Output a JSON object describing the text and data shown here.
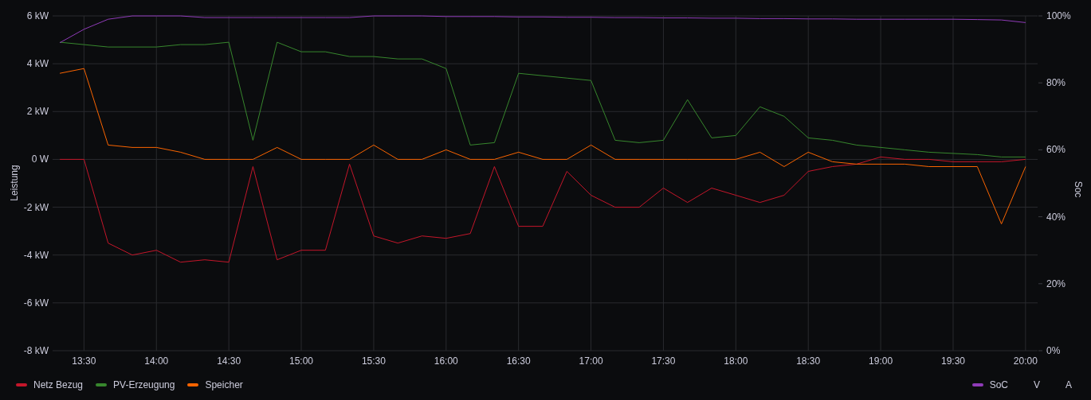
{
  "panel": {
    "chart_data": {
      "type": "line",
      "ylabel": "Leistung",
      "y2label": "Soc",
      "x": [
        800,
        810,
        820,
        830,
        840,
        850,
        860,
        870,
        880,
        890,
        900,
        910,
        920,
        930,
        940,
        950,
        960,
        970,
        980,
        990,
        1000,
        1010,
        1020,
        1030,
        1040,
        1050,
        1060,
        1070,
        1080,
        1090,
        1100,
        1110,
        1120,
        1130,
        1140,
        1150,
        1160,
        1170,
        1180,
        1190,
        1200
      ],
      "xticks": [
        {
          "value": 810,
          "label": "13:30"
        },
        {
          "value": 840,
          "label": "14:00"
        },
        {
          "value": 870,
          "label": "14:30"
        },
        {
          "value": 900,
          "label": "15:00"
        },
        {
          "value": 930,
          "label": "15:30"
        },
        {
          "value": 960,
          "label": "16:00"
        },
        {
          "value": 990,
          "label": "16:30"
        },
        {
          "value": 1020,
          "label": "17:00"
        },
        {
          "value": 1050,
          "label": "17:30"
        },
        {
          "value": 1080,
          "label": "18:00"
        },
        {
          "value": 1110,
          "label": "18:30"
        },
        {
          "value": 1140,
          "label": "19:00"
        },
        {
          "value": 1170,
          "label": "19:30"
        },
        {
          "value": 1200,
          "label": "20:00"
        }
      ],
      "xlim": [
        797,
        1205
      ],
      "grid": true,
      "ylim": [
        -8,
        6
      ],
      "yticks": [
        {
          "value": 6,
          "label": "6 kW"
        },
        {
          "value": 4,
          "label": "4 kW"
        },
        {
          "value": 2,
          "label": "2 kW"
        },
        {
          "value": 0,
          "label": "0 W"
        },
        {
          "value": -2,
          "label": "-2 kW"
        },
        {
          "value": -4,
          "label": "-4 kW"
        },
        {
          "value": -6,
          "label": "-6 kW"
        },
        {
          "value": -8,
          "label": "-8 kW"
        }
      ],
      "y2lim": [
        0,
        100
      ],
      "y2ticks": [
        {
          "value": 100,
          "label": "100%"
        },
        {
          "value": 80,
          "label": "80%"
        },
        {
          "value": 60,
          "label": "60%"
        },
        {
          "value": 40,
          "label": "40%"
        },
        {
          "value": 20,
          "label": "20%"
        },
        {
          "value": 0,
          "label": "0%"
        }
      ],
      "series": [
        {
          "name": "Netz Bezug",
          "color": "#c4162a",
          "values": [
            0,
            0,
            -3.5,
            -4,
            -3.8,
            -4.3,
            -4.2,
            -4.3,
            -0.3,
            -4.2,
            -3.8,
            -3.8,
            -0.2,
            -3.2,
            -3.5,
            -3.2,
            -3.3,
            -3.1,
            -0.3,
            -2.8,
            -2.8,
            -0.5,
            -1.5,
            -2,
            -2,
            -1.2,
            -1.8,
            -1.2,
            -1.5,
            -1.8,
            -1.5,
            -0.5,
            -0.3,
            -0.2,
            0.1,
            0,
            0,
            -0.1,
            -0.1,
            -0.1,
            0
          ]
        },
        {
          "name": "PV-Erzeugung",
          "color": "#37872d",
          "values": [
            4.9,
            4.8,
            4.7,
            4.7,
            4.7,
            4.8,
            4.8,
            4.9,
            0.8,
            4.9,
            4.5,
            4.5,
            4.3,
            4.3,
            4.2,
            4.2,
            3.8,
            0.6,
            0.7,
            3.6,
            3.5,
            3.4,
            3.3,
            0.8,
            0.7,
            0.8,
            2.5,
            0.9,
            1,
            2.2,
            1.8,
            0.9,
            0.8,
            0.6,
            0.5,
            0.4,
            0.3,
            0.25,
            0.2,
            0.1,
            0.1
          ]
        },
        {
          "name": "Speicher",
          "color": "#fa6400",
          "values": [
            3.6,
            3.8,
            0.6,
            0.5,
            0.5,
            0.3,
            0,
            0,
            0,
            0.5,
            0,
            0,
            0,
            0.6,
            0,
            0,
            0.4,
            0,
            0,
            0.3,
            0,
            0,
            0.6,
            0,
            0,
            0,
            0,
            0,
            0,
            0.3,
            -0.3,
            0.3,
            -0.1,
            -0.2,
            -0.2,
            -0.2,
            -0.3,
            -0.3,
            -0.3,
            -2.7,
            -0.3
          ]
        },
        {
          "name": "SoC",
          "color": "#8f3bb8",
          "axis": "y2",
          "values": [
            92,
            96,
            99,
            100,
            100,
            100,
            99.5,
            99.5,
            99.5,
            99.5,
            99.5,
            99.5,
            99.5,
            100,
            100,
            100,
            99.8,
            99.8,
            99.8,
            99.7,
            99.7,
            99.6,
            99.6,
            99.5,
            99.5,
            99.4,
            99.4,
            99.3,
            99.3,
            99.2,
            99.2,
            99.1,
            99.1,
            99,
            99,
            99,
            99,
            99,
            98.9,
            98.8,
            98
          ]
        }
      ]
    },
    "extra_legend": [
      "V",
      "A"
    ]
  }
}
